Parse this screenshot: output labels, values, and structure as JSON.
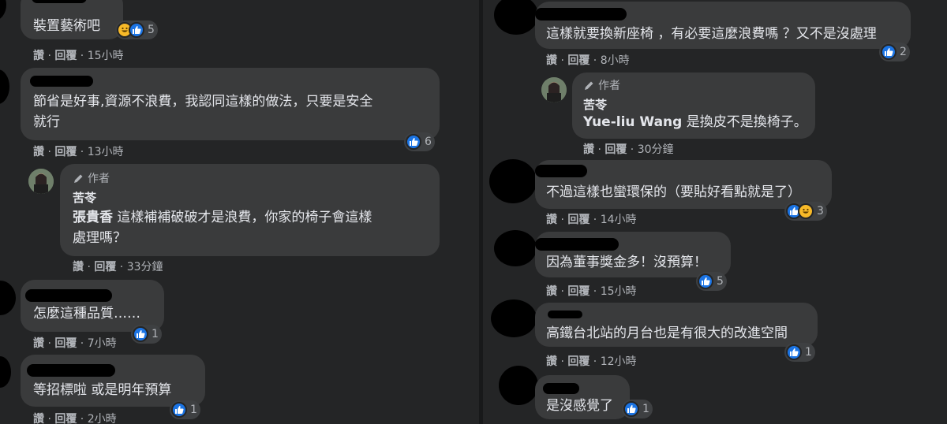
{
  "actions": {
    "like": "讚",
    "reply": "回覆",
    "sep": " · "
  },
  "author_tag": "作者",
  "left": [
    {
      "text": "裝置藝術吧",
      "time": "15小時",
      "reactions": "5"
    },
    {
      "text": "節省是好事,資源不浪費，我認同這樣的做法，只要是安全\n就行",
      "time": "13小時",
      "reactions": "6"
    },
    {
      "author_reply": true,
      "name": "苦苓",
      "mention": "張貴香",
      "text": " 這樣補補破破才是浪費，你家的椅子會這樣\n處理嗎？",
      "time": "33分鐘"
    },
    {
      "text": "怎麼這種品質……",
      "time": "7小時",
      "reactions": "1"
    },
    {
      "text": "等招標啦 或是明年預算",
      "time": "2小時",
      "reactions": "1"
    }
  ],
  "right": [
    {
      "text": "這樣就要換新座椅 ，有必要這麼浪費嗎 ？又不是沒處理",
      "time": "8小時",
      "reactions": "2"
    },
    {
      "author_reply": true,
      "name": "苦苓",
      "mention": "Yue-liu Wang",
      "text": " 是換皮不是換椅子。",
      "time": "30分鐘"
    },
    {
      "text": "不過這樣也蠻環保的（要貼好看點就是了）",
      "time": "14小時",
      "reactions": "3"
    },
    {
      "text": "因為董事獎金多！沒預算！",
      "time": "15小時",
      "reactions": "5"
    },
    {
      "text": "高鐵台北站的月台也是有很大的改進空間",
      "time": "12小時",
      "reactions": "1"
    },
    {
      "text": "是沒感覺了",
      "reactions": "1"
    }
  ],
  "colors": {
    "page": "#18191a",
    "panel": "#242526",
    "bubble": "#3a3b3c",
    "like": "#1b74e4",
    "haha": "#f7b928",
    "meta": "#b0b3b8"
  },
  "icons": {
    "like": "thumbs-up-icon",
    "haha": "laughing-face-icon",
    "author": "pencil-icon"
  }
}
